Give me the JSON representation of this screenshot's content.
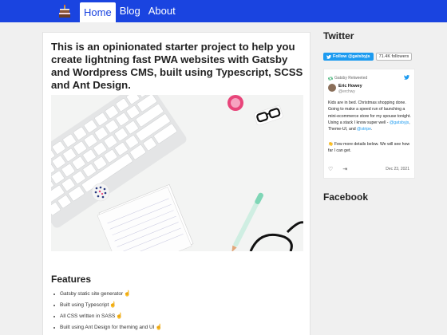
{
  "nav": {
    "logo_icon": "birthday-cake-icon",
    "items": [
      {
        "label": "Home",
        "active": true
      },
      {
        "label": "Blog",
        "active": false
      },
      {
        "label": "About",
        "active": false
      }
    ]
  },
  "main": {
    "title": "This is an opinionated starter project to help you create lightning fast PWA websites with Gatsby and Wordpress CMS, built using Typescript, SCSS and Ant Design.",
    "features_heading": "Features",
    "features": [
      "Gatsby static site generator",
      "Built using Typescript",
      "All CSS written in SASS",
      "Built using Ant Design for theming and UI"
    ],
    "feature_icon": "pointing-hand-icon"
  },
  "sidebar": {
    "twitter_heading": "Twitter",
    "follow_label": "Follow @gatsbyjs",
    "follower_count": "71.4K followers",
    "tweet": {
      "retweeted_by": "Gatsby Retweeted",
      "author_name": "Eric Howey",
      "author_handle": "@erchwy",
      "text_part1": "Kids are in bed. Christmas shopping done. Going to make a speed run of launching a mini-ecommerce store for my spouse tonight. Using a stack I know super well - ",
      "link1": "@gatsbyjs",
      "text_part2": ", Theme-UI, and ",
      "link2": "@stripe",
      "text_part3": ".",
      "text_second": "👏 Few more details below. We will see how far I can get.",
      "date": "Dec 23, 2021"
    },
    "facebook_heading": "Facebook"
  },
  "colors": {
    "nav_bg": "#1a44e0",
    "twitter_blue": "#1d9bf0"
  }
}
